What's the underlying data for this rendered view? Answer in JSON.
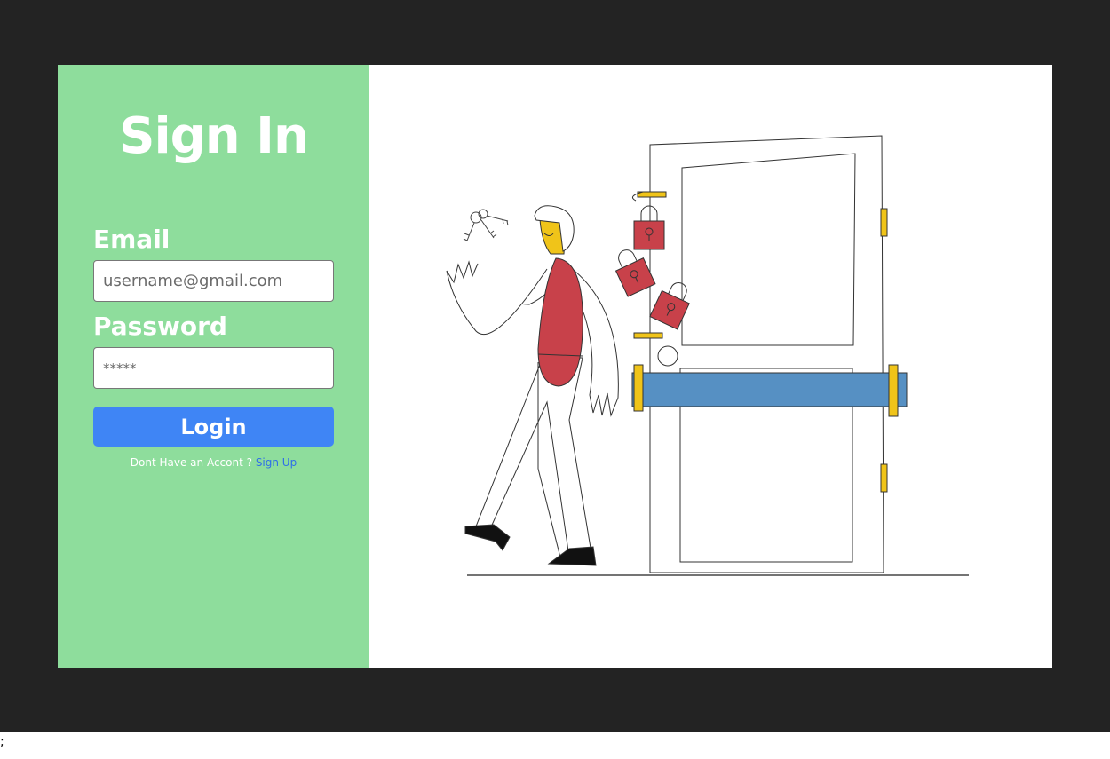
{
  "signin": {
    "title": "Sign In",
    "email_label": "Email",
    "email_placeholder": "username@gmail.com",
    "password_label": "Password",
    "password_placeholder": "*****",
    "login_label": "Login",
    "no_account_text": "Dont Have an Accont ?",
    "signup_link": "Sign Up"
  },
  "illustration": {
    "icons": [
      "keys-icon",
      "padlock-icon",
      "door-icon",
      "person-icon"
    ]
  },
  "stray_text": ";",
  "colors": {
    "backdrop": "#232323",
    "left_panel": "#8EDD9C",
    "button": "#3F85F5",
    "link": "#2F6FE8",
    "padlock": "#C8414A",
    "bar": "#5690C3",
    "hinge": "#F0C419"
  }
}
